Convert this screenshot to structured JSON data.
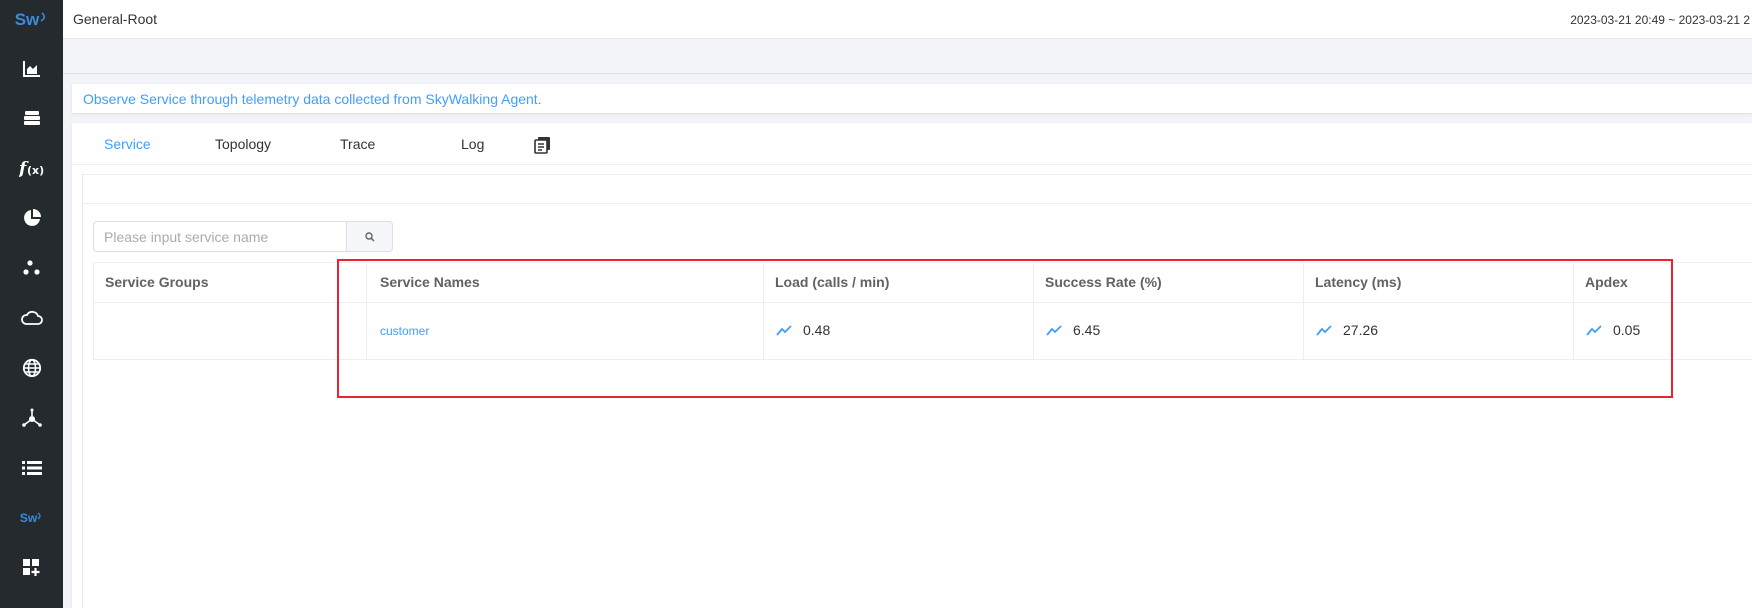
{
  "sidebar": {
    "logo": "Sw",
    "items": [
      {
        "icon": "marketplace-chart-icon"
      },
      {
        "icon": "database-icon"
      },
      {
        "icon": "function-icon"
      },
      {
        "icon": "pie-chart-icon"
      },
      {
        "icon": "dots-cluster-icon"
      },
      {
        "icon": "cloud-icon"
      },
      {
        "icon": "globe-icon"
      },
      {
        "icon": "network-icon"
      },
      {
        "icon": "list-icon"
      },
      {
        "icon": "skywalking-icon",
        "label": "Sw"
      },
      {
        "icon": "dashboard-add-icon"
      }
    ],
    "colors": {
      "bg": "#252a2f",
      "accent": "#3d8bd9"
    }
  },
  "header": {
    "title": "General-Root",
    "time_range": "2023-03-21 20:49 ~ 2023-03-21 2"
  },
  "description": "Observe Service through telemetry data collected from SkyWalking Agent.",
  "tabs": [
    {
      "label": "Service",
      "active": true
    },
    {
      "label": "Topology",
      "active": false
    },
    {
      "label": "Trace",
      "active": false
    },
    {
      "label": "Log",
      "active": false
    }
  ],
  "tab_tool_icon": "copy-document-icon",
  "search": {
    "placeholder": "Please input service name",
    "value": "",
    "button_icon": "search-icon"
  },
  "table": {
    "columns": [
      "Service Groups",
      "Service Names",
      "Load (calls / min)",
      "Success Rate (%)",
      "Latency (ms)",
      "Apdex"
    ],
    "rows": [
      {
        "group": "",
        "name": "customer",
        "load": "0.48",
        "success_rate": "6.45",
        "latency": "27.26",
        "apdex": "0.05"
      }
    ]
  },
  "colors": {
    "link": "#409eff",
    "highlight_border": "#e6262e"
  }
}
